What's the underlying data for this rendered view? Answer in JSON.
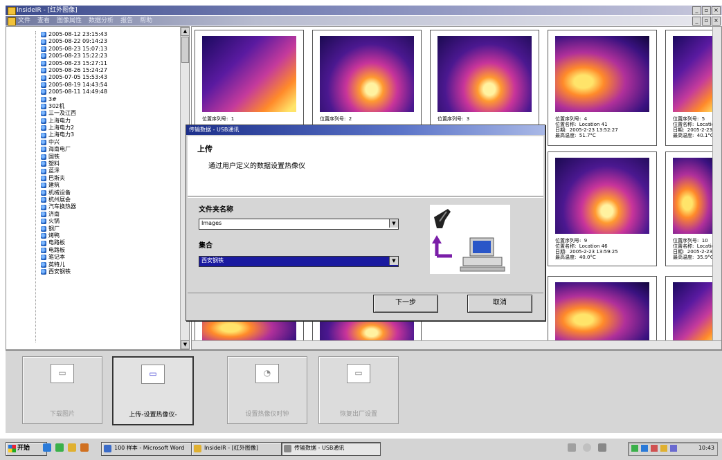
{
  "window": {
    "title": "InsideIR - [红外图像]",
    "controls": [
      "_",
      "▫",
      "×"
    ]
  },
  "menu": [
    "文件",
    "查看",
    "图像属性",
    "数据分析",
    "报告",
    "帮助"
  ],
  "tree": {
    "items": [
      "2005-08-12 23:15:43",
      "2005-08-22 09:14:23",
      "2005-08-23 15:07:13",
      "2005-08-23 15:22:23",
      "2005-08-23 15:27:11",
      "2005-08-26 15:24:27",
      "2005-07-05 15:53:43",
      "2005-08-19 14:43:54",
      "2005-08-11 14:49:48",
      "3#",
      "302机",
      "三一及江西",
      "上海电力",
      "上海电力2",
      "上海电力3",
      "中兴",
      "海南电厂",
      "国铁",
      "塑料",
      "蓝泽",
      "巴斯夫",
      "建筑",
      "机械设备",
      "杭州展会",
      "汽车换热器",
      "济南",
      "火锅",
      "钢厂",
      "烤鸭",
      "电路板",
      "电路板",
      "笔记本",
      "英特儿",
      "西安钢铁"
    ]
  },
  "gallery": {
    "cards": [
      {
        "caption": "位置序列号:  1"
      },
      {
        "caption": "位置序列号:  2"
      },
      {
        "caption": "位置序列号:  3"
      },
      {
        "caption": "位置序列号:  4\n位置名称:  Location 41\n日期:  2005-2-23 13:52:27\n最高温度:  51.7°C"
      },
      {
        "caption": "位置序列号:  5\n位置名称:  Location\n日期:  2005-2-23 1\n最高温度:  40.1°C"
      },
      {
        "caption": "位置序列号:  9\n位置名称:  Location 46\n日期:  2005-2-23 13:59:25\n最高温度:  40.0°C"
      },
      {
        "caption": "位置序列号:  10\n位置名称:  Location\n日期:  2005-2-23 14\n最高温度:  35.9°C"
      },
      {
        "caption": ""
      },
      {
        "caption": ""
      },
      {
        "caption": ""
      },
      {
        "caption": ""
      }
    ]
  },
  "dialog": {
    "title": "传输数据 - USB通讯",
    "heading": "上传",
    "description": "通过用户定义的数据设置热像仪",
    "folder_label": "文件夹名称",
    "folder_value": "Images",
    "set_label": "集合",
    "set_value": "西安钢铁",
    "next_button": "下一步",
    "cancel_button": "取消"
  },
  "toolbar": {
    "buttons": [
      {
        "label": "下载图片",
        "icon": "▭"
      },
      {
        "label": "上传-设置热像仪-",
        "icon": "▭"
      },
      {
        "label": "设置热像仪时钟",
        "icon": "◔"
      },
      {
        "label": "恢复出厂设置",
        "icon": "▭"
      }
    ]
  },
  "taskbar": {
    "start": "开始",
    "tasks": [
      "100 样本 - Microsoft Word",
      "InsideIR - [红外图像]",
      "传输数据 - USB通讯"
    ],
    "clock": "10:43"
  }
}
